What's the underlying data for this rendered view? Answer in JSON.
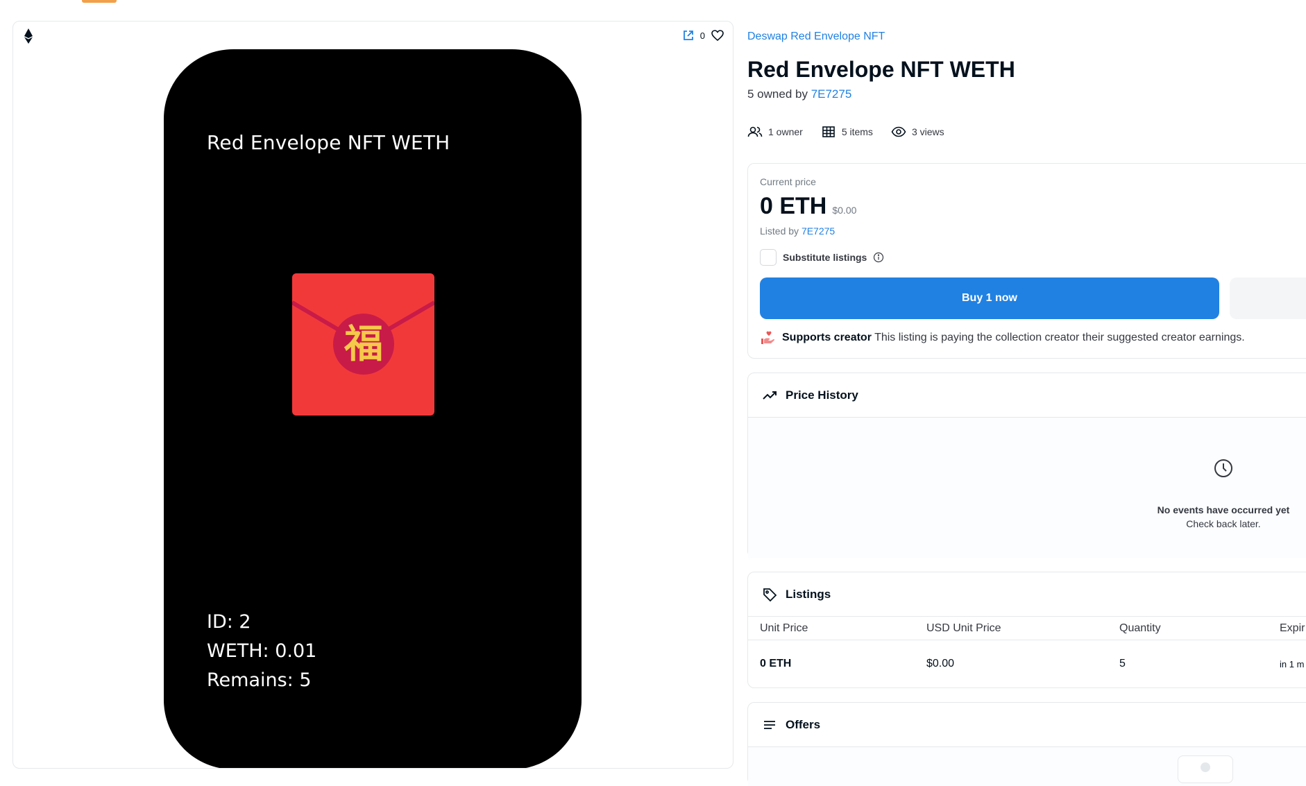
{
  "media": {
    "favorite_count": "0",
    "nft_title": "Red Envelope NFT WETH",
    "fu_character": "福",
    "id_line": "ID: 2",
    "weth_line": "WETH: 0.01",
    "remains_line": "Remains: 5"
  },
  "asset": {
    "collection_name": "Deswap Red Envelope NFT",
    "title": "Red Envelope NFT WETH",
    "owned_prefix": "5 owned by ",
    "owner": "7E7275"
  },
  "stats": {
    "owners": "1 owner",
    "items": "5 items",
    "views": "3 views"
  },
  "price": {
    "label": "Current price",
    "amount": "0 ETH",
    "usd": "$0.00",
    "listed_prefix": "Listed by ",
    "lister": "7E7275",
    "substitute_label": "Substitute listings",
    "buy_label": "Buy 1 now",
    "supports_bold": "Supports creator",
    "supports_text": " This listing is paying the collection creator their suggested creator earnings."
  },
  "price_history": {
    "heading": "Price History",
    "empty_title": "No events have occurred yet",
    "empty_sub": "Check back later."
  },
  "listings": {
    "heading": "Listings",
    "columns": [
      "Unit Price",
      "USD Unit Price",
      "Quantity",
      "Expir"
    ],
    "rows": [
      [
        "0 ETH",
        "$0.00",
        "5",
        "in 1 m"
      ]
    ]
  },
  "offers": {
    "heading": "Offers"
  },
  "colors": {
    "accent": "#2081e2",
    "envelope_red": "#f2393a",
    "fu_gold": "#f5c94a"
  }
}
